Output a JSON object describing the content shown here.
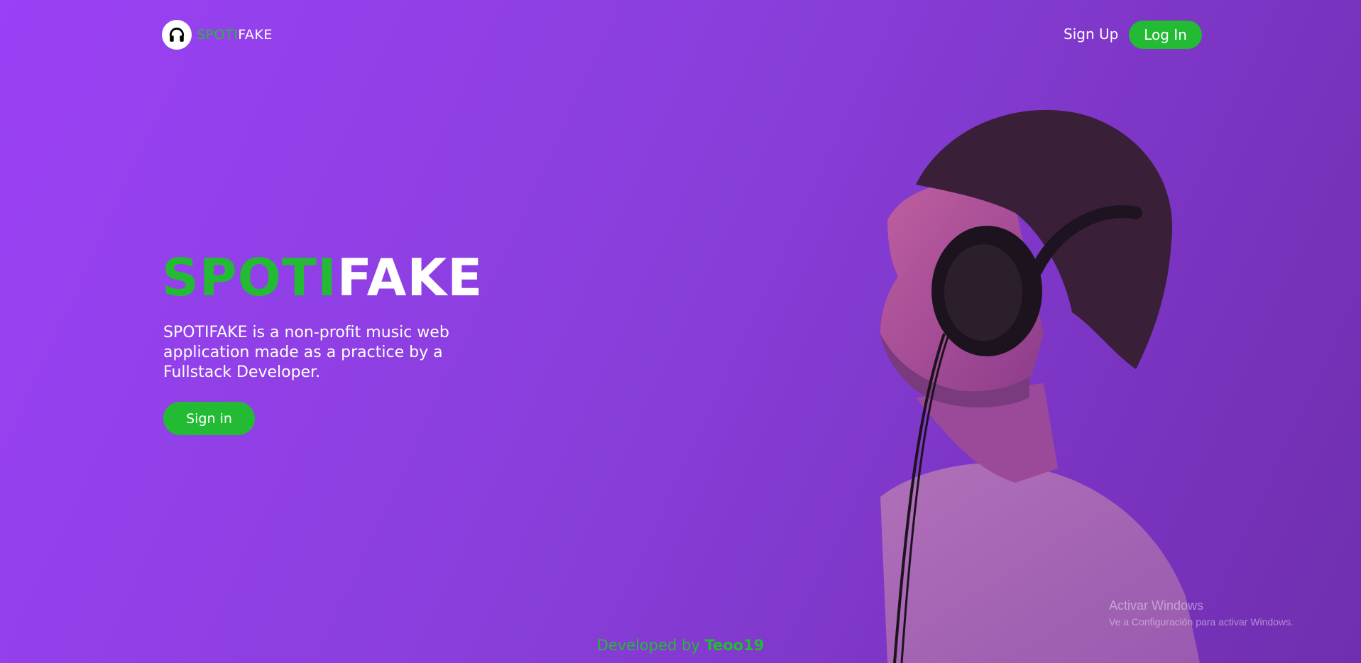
{
  "brand": {
    "name_part1": "SPOTI",
    "name_part2": "FAKE",
    "logo_icon": "headphones-icon"
  },
  "nav": {
    "signup_label": "Sign Up",
    "login_label": "Log In"
  },
  "hero": {
    "title_part1": "SPOTI",
    "title_part2": "FAKE",
    "description": "SPOTIFAKE is a non-profit music web application made as a practice by a Fullstack Developer.",
    "button_label": "Sign in"
  },
  "footer": {
    "prefix": "Developed by ",
    "author": "Teoo19"
  },
  "watermark": {
    "title": "Activar Windows",
    "subtitle": "Ve a Configuración para activar Windows."
  },
  "colors": {
    "accent": "#22bb33",
    "background": "#8a3fdc",
    "text": "#ffffff"
  }
}
